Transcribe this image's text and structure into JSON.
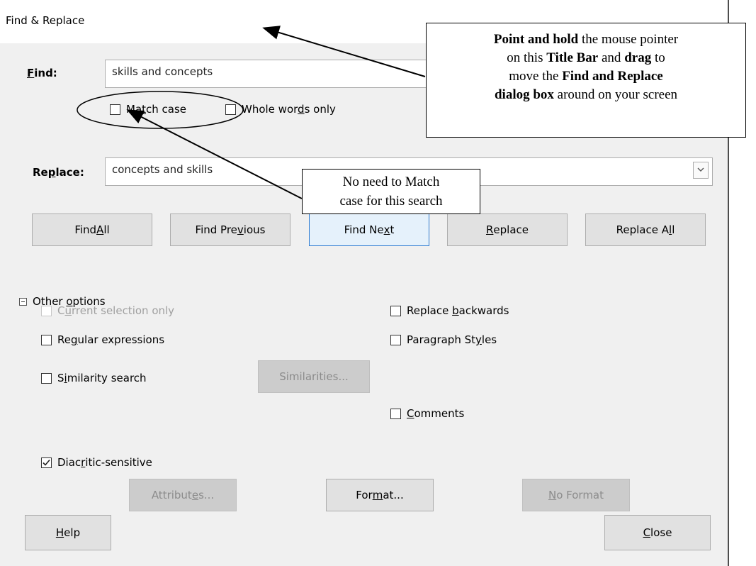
{
  "dialog": {
    "title": "Find & Replace"
  },
  "find": {
    "label_pre": "",
    "label_ul": "F",
    "label_post": "ind:",
    "value": "skills and concepts"
  },
  "replace": {
    "label_pre": "Re",
    "label_ul": "p",
    "label_post": "lace:",
    "value": "concepts and skills"
  },
  "options_top": {
    "match_case": {
      "pre": "Ma",
      "ul": "t",
      "post": "ch case",
      "checked": false
    },
    "whole_words": {
      "pre": "Whole wor",
      "ul": "d",
      "post": "s only",
      "checked": false
    }
  },
  "buttons": {
    "find_all": {
      "pre": "Find ",
      "ul": "A",
      "post": "ll"
    },
    "find_previous": {
      "pre": "Find Pre",
      "ul": "v",
      "post": "ious"
    },
    "find_next": {
      "pre": "Find Ne",
      "ul": "x",
      "post": "t"
    },
    "replace": {
      "pre": "",
      "ul": "R",
      "post": "eplace"
    },
    "replace_all": {
      "pre": "Replace A",
      "ul": "l",
      "post": "l"
    }
  },
  "other_options": {
    "header": {
      "pre": "Other ",
      "ul": "o",
      "post": "ptions"
    },
    "current_selection": {
      "pre": "C",
      "ul": "u",
      "post": "rrent selection only",
      "disabled": true
    },
    "regular_expressions": {
      "pre": "Re",
      "ul": "g",
      "post": "ular expressions"
    },
    "similarity_search": {
      "pre": "S",
      "ul": "i",
      "post": "milarity search"
    },
    "similarities_button": "Similarities...",
    "replace_backwards": {
      "pre": "Replace ",
      "ul": "b",
      "post": "ackwards"
    },
    "paragraph_styles": {
      "pre": "Paragraph St",
      "ul": "y",
      "post": "les"
    },
    "comments": {
      "pre": "",
      "ul": "C",
      "post": "omments"
    },
    "diacritic": {
      "pre": "Diac",
      "ul": "r",
      "post": "itic-sensitive",
      "checked": true
    }
  },
  "bottom_buttons": {
    "attributes": {
      "pre": "Attribut",
      "ul": "e",
      "post": "s..."
    },
    "format": {
      "pre": "For",
      "ul": "m",
      "post": "at..."
    },
    "no_format": {
      "pre": "",
      "ul": "N",
      "post": "o Format"
    },
    "help": {
      "pre": "",
      "ul": "H",
      "post": "elp"
    },
    "close": {
      "pre": "",
      "ul": "C",
      "post": "lose"
    }
  },
  "callouts": {
    "title_bar": {
      "l1_b": "Point and hold",
      "l1": " the mouse pointer",
      "l2": "on this ",
      "l2_b": "Title Bar",
      "l2_m": " and ",
      "l2_b2": "drag",
      "l2_e": " to",
      "l3": "move the ",
      "l3_b": "Find and Replace",
      "l4_b": "dialog box",
      "l4": " around on your screen"
    },
    "match_case": {
      "l1": "No need to Match",
      "l2": "case for this search"
    }
  }
}
